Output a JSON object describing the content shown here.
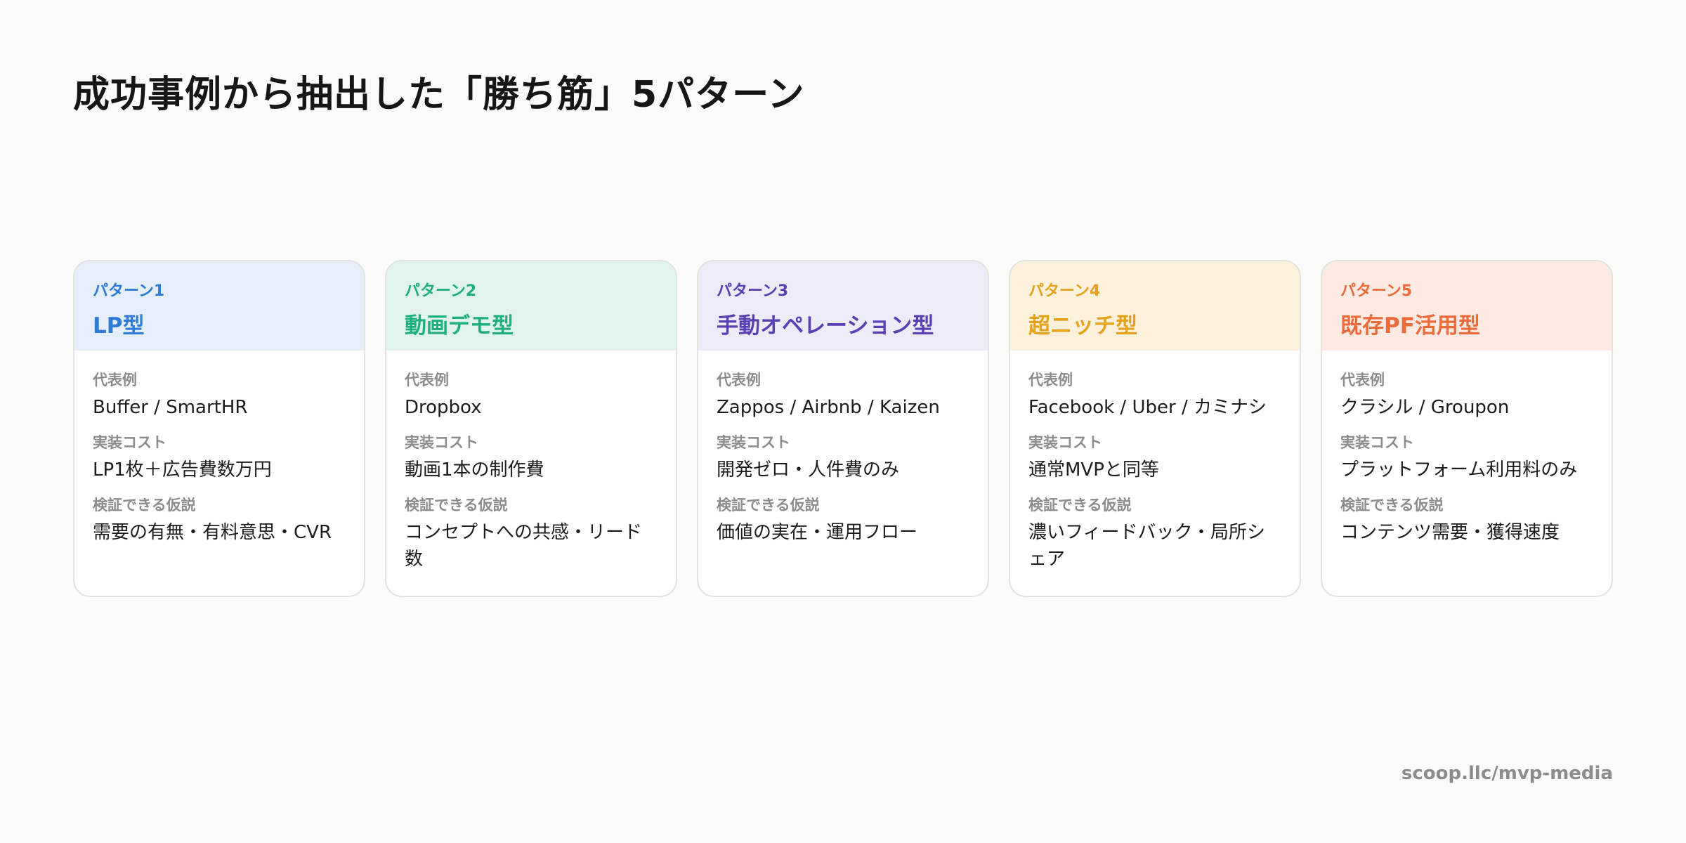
{
  "title": "成功事例から抽出した「勝ち筋」5パターン",
  "labels": {
    "examples": "代表例",
    "cost": "実装コスト",
    "hypothesis": "検証できる仮説"
  },
  "patterns": [
    {
      "number": "パターン1",
      "name": "LP型",
      "accent": "#2f7bd8",
      "header_bg": "#e5eef9",
      "examples": "Buffer / SmartHR",
      "cost": "LP1枚＋広告費数万円",
      "hypothesis": "需要の有無・有料意思・CVR"
    },
    {
      "number": "パターン2",
      "name": "動画デモ型",
      "accent": "#1fae7d",
      "header_bg": "#e1f4ec",
      "examples": "Dropbox",
      "cost": "動画1本の制作費",
      "hypothesis": "コンセプトへの共感・リード数"
    },
    {
      "number": "パターン3",
      "name": "手動オペレーション型",
      "accent": "#5a3fb4",
      "header_bg": "#ecebf7",
      "examples": "Zappos / Airbnb / Kaizen",
      "cost": "開発ゼロ・人件費のみ",
      "hypothesis": "価値の実在・運用フロー"
    },
    {
      "number": "パターン4",
      "name": "超ニッチ型",
      "accent": "#e6a21d",
      "header_bg": "#fcf1db",
      "examples": "Facebook / Uber / カミナシ",
      "cost": "通常MVPと同等",
      "hypothesis": "濃いフィードバック・局所シェア"
    },
    {
      "number": "パターン5",
      "name": "既存PF活用型",
      "accent": "#ec6b3b",
      "header_bg": "#fdeae3",
      "examples": "クラシル / Groupon",
      "cost": "プラットフォーム利用料のみ",
      "hypothesis": "コンテンツ需要・獲得速度"
    }
  ],
  "footer": "scoop.llc/mvp-media"
}
